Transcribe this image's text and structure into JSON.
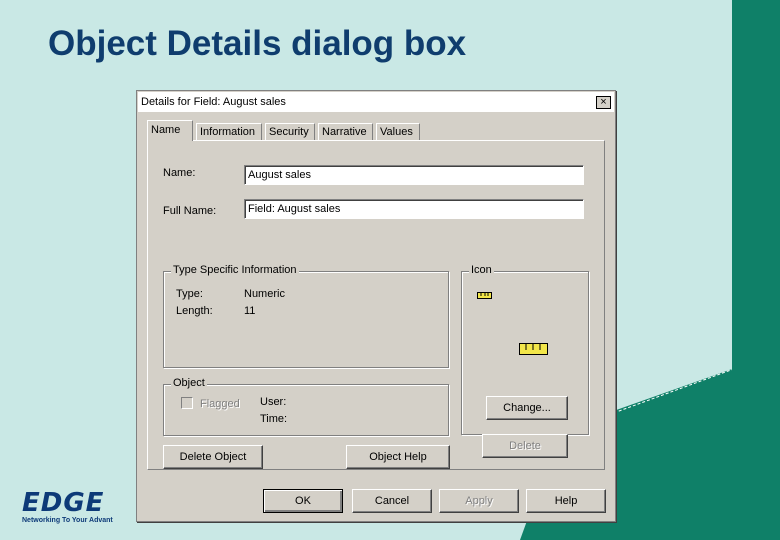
{
  "slide": {
    "title": "Object Details dialog box",
    "logo": {
      "name": "EDGE",
      "tagline": "Networking To Your Advant"
    }
  },
  "colors": {
    "background": "#c9e8e5",
    "title": "#0f3d6e",
    "accent": "#0f8068",
    "dialog": "#d4d0c8"
  },
  "dialog": {
    "title": "Details for Field: August sales",
    "close_label": "×",
    "tabs": [
      {
        "label": "Name",
        "active": true
      },
      {
        "label": "Information"
      },
      {
        "label": "Security"
      },
      {
        "label": "Narrative"
      },
      {
        "label": "Values"
      }
    ],
    "name_label": "Name:",
    "name_value": "August sales",
    "full_name_label": "Full Name:",
    "full_name_value": "Field: August sales",
    "type_group": {
      "legend": "Type Specific Information",
      "type_label": "Type:",
      "type_value": "Numeric",
      "length_label": "Length:",
      "length_value": "11"
    },
    "icon_group": {
      "legend": "Icon",
      "icon_small": "ruler-small-icon",
      "icon_large": "ruler-large-icon"
    },
    "object_group": {
      "legend": "Object",
      "flagged_label": "Flagged",
      "user_label": "User:",
      "time_label": "Time:"
    },
    "buttons": {
      "change": "Change...",
      "delete": "Delete",
      "delete_object": "Delete Object",
      "object_help": "Object Help",
      "ok": "OK",
      "cancel": "Cancel",
      "apply": "Apply",
      "help": "Help"
    }
  }
}
